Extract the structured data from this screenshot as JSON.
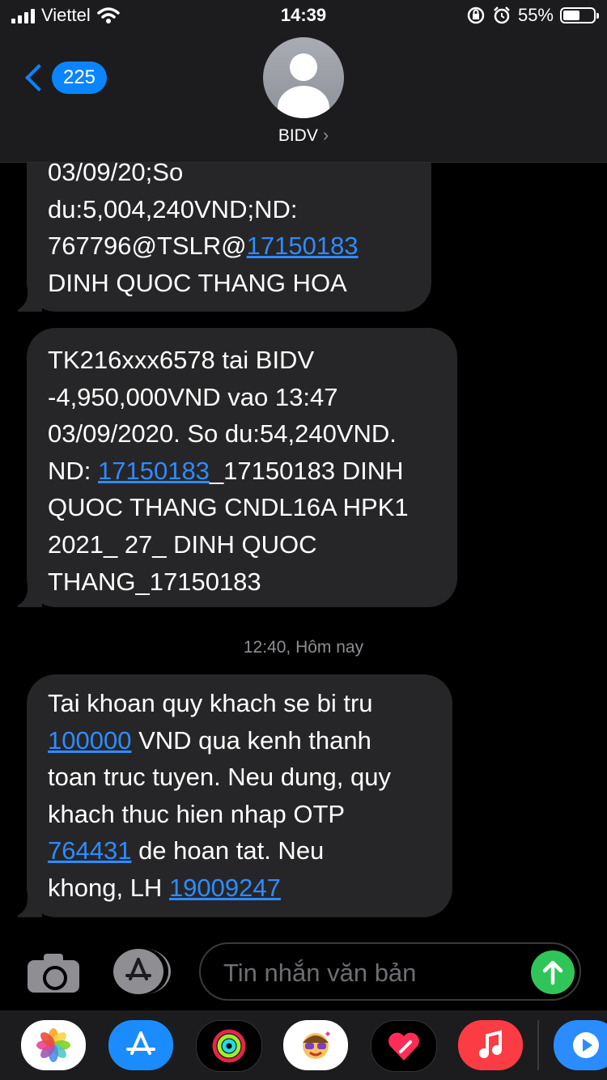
{
  "status_bar": {
    "carrier": "Viettel",
    "time": "14:39",
    "battery_percent": "55%",
    "battery_level": 0.55
  },
  "header": {
    "back_count": "225",
    "contact_name": "BIDV",
    "contact_chevron": "›"
  },
  "messages": [
    {
      "lines": [
        [
          {
            "text": "03/09/20;So"
          }
        ],
        [
          {
            "text": "du:5,004,240VND;ND:"
          }
        ],
        [
          {
            "text": "767796@TSLR@"
          },
          {
            "text": "17150183",
            "link": true
          }
        ],
        [
          {
            "text": "DINH QUOC THANG HOA"
          }
        ]
      ]
    },
    {
      "lines": [
        [
          {
            "text": "TK216xxx6578 tai BIDV"
          }
        ],
        [
          {
            "text": "-4,950,000VND vao 13:47"
          }
        ],
        [
          {
            "text": "03/09/2020. So du:54,240VND."
          }
        ],
        [
          {
            "text": "ND: "
          },
          {
            "text": "17150183",
            "link": true
          },
          {
            "text": "_17150183 DINH"
          }
        ],
        [
          {
            "text": "QUOC THANG CNDL16A HPK1"
          }
        ],
        [
          {
            "text": "2021_ 27_ DINH QUOC"
          }
        ],
        [
          {
            "text": "THANG_17150183"
          }
        ]
      ]
    },
    {
      "lines": [
        [
          {
            "text": "Tai khoan quy khach se bi tru"
          }
        ],
        [
          {
            "text": "100000",
            "link": true
          },
          {
            "text": " VND qua kenh thanh"
          }
        ],
        [
          {
            "text": "toan truc tuyen. Neu dung, quy"
          }
        ],
        [
          {
            "text": "khach thuc hien nhap OTP"
          }
        ],
        [
          {
            "text": "764431",
            "link": true
          },
          {
            "text": " de hoan tat. Neu"
          }
        ],
        [
          {
            "text": "khong, LH "
          },
          {
            "text": "19009247",
            "link": true
          }
        ]
      ]
    }
  ],
  "timestamp": "12:40, Hôm nay",
  "compose": {
    "placeholder": "Tin nhắn văn bản",
    "send_icon": "arrow-up-icon"
  },
  "app_drawer": [
    {
      "name": "photos-app-icon"
    },
    {
      "name": "app-store-app-icon"
    },
    {
      "name": "activity-app-icon"
    },
    {
      "name": "memoji-app-icon"
    },
    {
      "name": "digital-touch-app-icon"
    },
    {
      "name": "music-app-icon"
    },
    {
      "name": "clips-app-icon"
    }
  ],
  "colors": {
    "bubble": "#262628",
    "link": "#2f8bff",
    "accent": "#0a84ff",
    "send": "#30c559"
  }
}
